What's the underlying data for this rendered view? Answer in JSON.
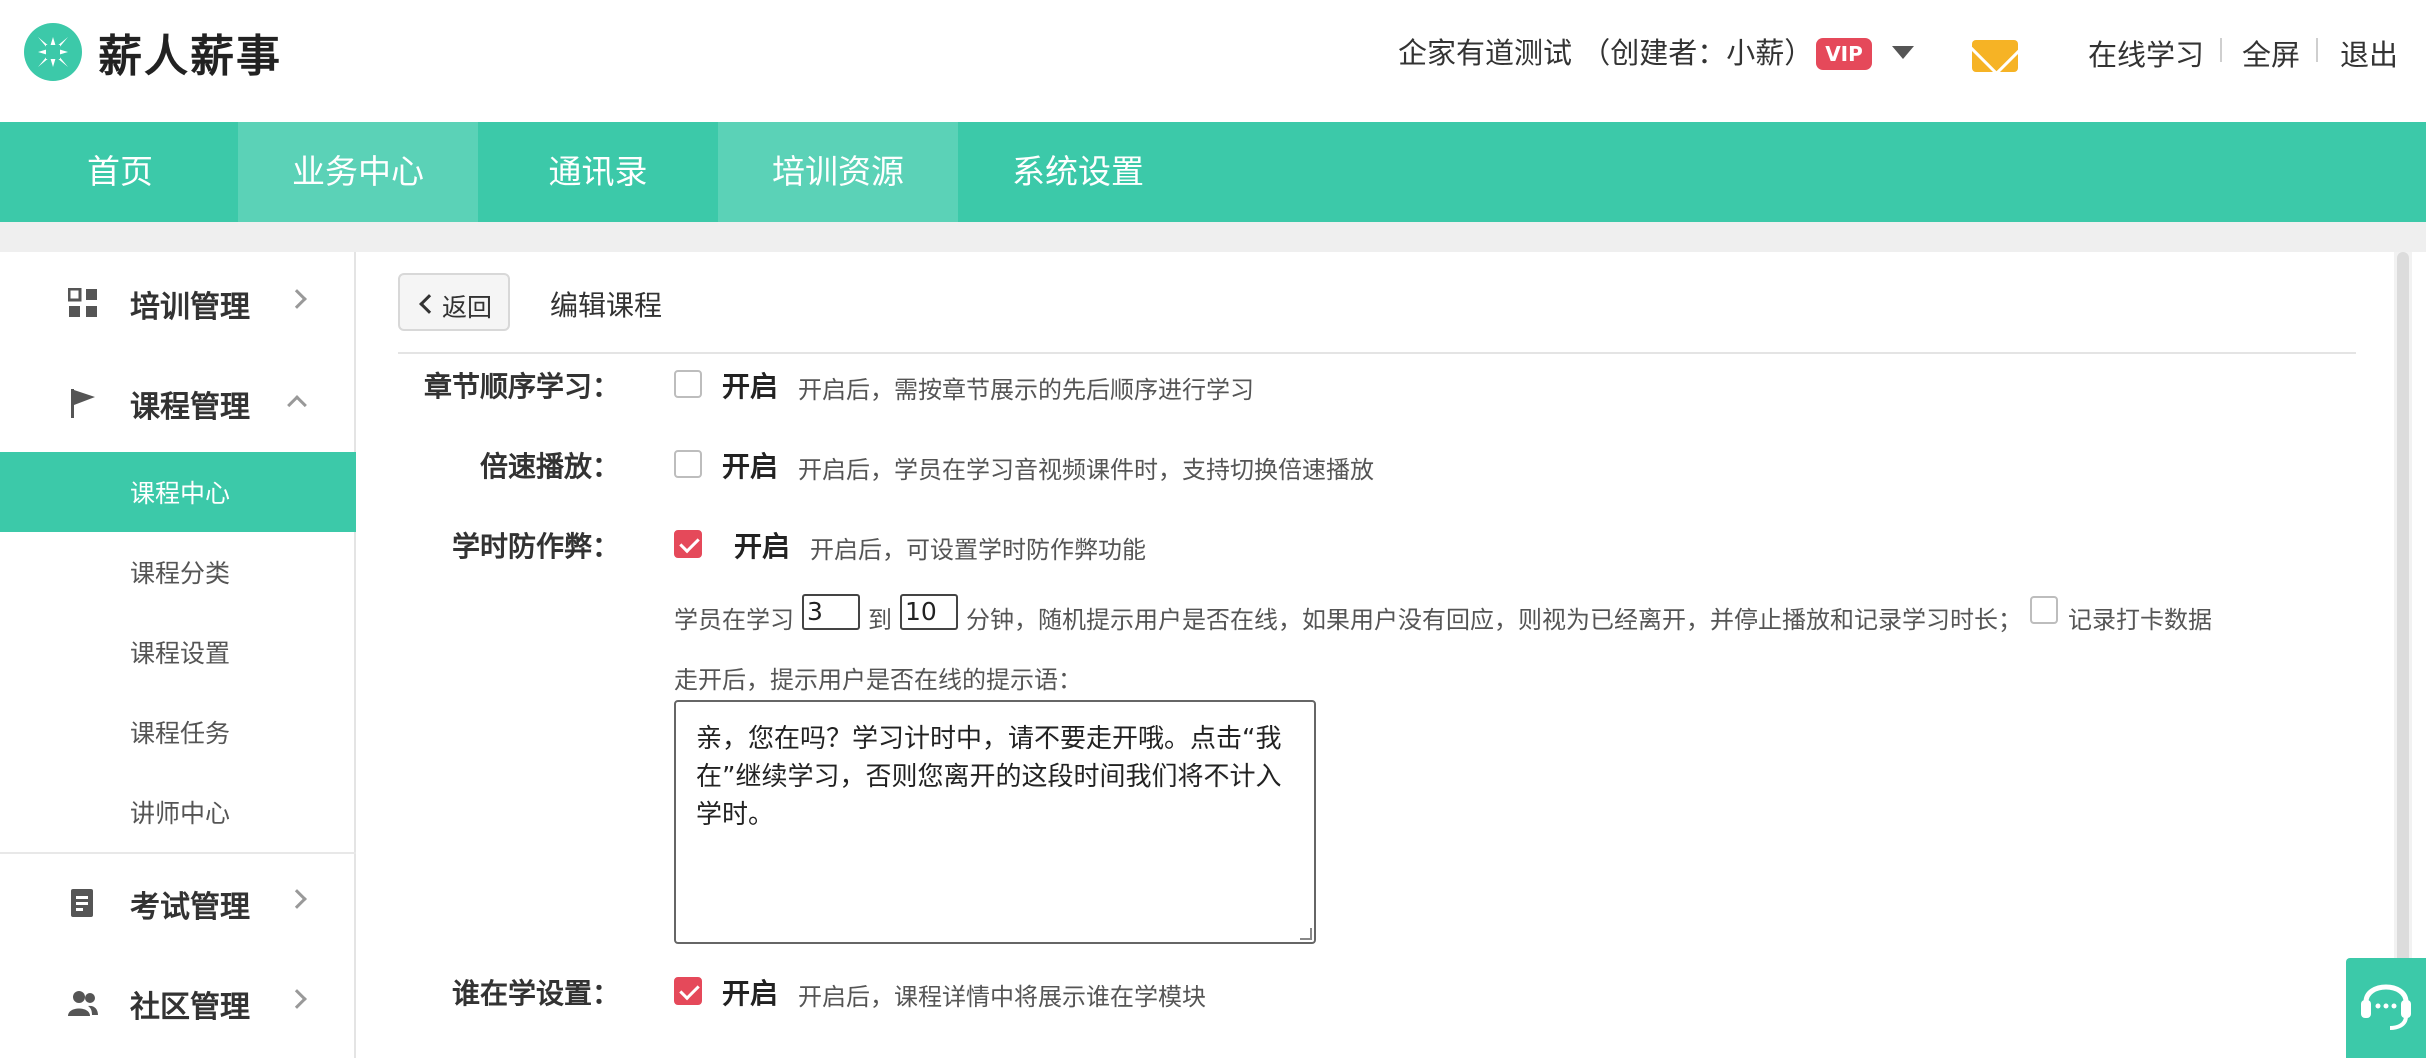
{
  "brand": {
    "name": "薪人薪事"
  },
  "header": {
    "company": "企家有道测试 （创建者：小薪）",
    "vip_badge": "VIP",
    "online_learning": "在线学习",
    "fullscreen": "全屏",
    "logout": "退出"
  },
  "mainnav": {
    "items": [
      {
        "label": "首页"
      },
      {
        "label": "业务中心"
      },
      {
        "label": "通讯录"
      },
      {
        "label": "培训资源"
      },
      {
        "label": "系统设置"
      }
    ]
  },
  "sidebar": {
    "training": "培训管理",
    "course": "课程管理",
    "course_sub": [
      "课程中心",
      "课程分类",
      "课程设置",
      "课程任务",
      "讲师中心"
    ],
    "exam": "考试管理",
    "community": "社区管理"
  },
  "page": {
    "back": "返回",
    "title": "编辑课程"
  },
  "form": {
    "chapter_order": {
      "label": "章节顺序学习：",
      "on": "开启",
      "checked": false,
      "desc": "开启后，需按章节展示的先后顺序进行学习"
    },
    "speed": {
      "label": "倍速播放：",
      "on": "开启",
      "checked": false,
      "desc": "开启后，学员在学习音视频课件时，支持切换倍速播放"
    },
    "anticheat": {
      "label": "学时防作弊：",
      "on": "开启",
      "checked": true,
      "desc": "开启后，可设置学时防作弊功能",
      "line_prefix": "学员在学习",
      "min_value": "3",
      "to": "到",
      "max_value": "10",
      "line_suffix": "分钟，随机提示用户是否在线，如果用户没有回应，则视为已经离开，并停止播放和记录学习时长；",
      "record_label": "记录打卡数据",
      "record_checked": false,
      "prompt_label": "走开后，提示用户是否在线的提示语：",
      "prompt_text": "亲，您在吗？学习计时中，请不要走开哦。点击“我在”继续学习，否则您离开的这段时间我们将不计入学时。"
    },
    "who_learning": {
      "label": "谁在学设置：",
      "on": "开启",
      "checked": true,
      "desc": "开启后，课程详情中将展示谁在学模块"
    }
  },
  "colors": {
    "primary": "#3cc9a9",
    "accent": "#e5495a",
    "mail": "#f6b325"
  }
}
